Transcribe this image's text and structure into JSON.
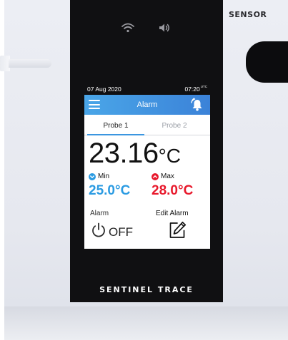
{
  "device": {
    "brand_label": "SENSOR",
    "device_name": "SENTINEL TRACE",
    "colors": {
      "case": "#e8eaf0",
      "bezel": "#101012",
      "screen_bg": "#ffffff"
    },
    "status_icons": [
      "wifi-icon",
      "speaker-icon"
    ]
  },
  "statusbar": {
    "date": "07 Aug 2020",
    "time": "07:20",
    "time_suffix": "UTC"
  },
  "appbar": {
    "title": "Alarm",
    "menu_icon": "hamburger-menu-icon",
    "action_icon": "alarm-bell-icon",
    "color": "#3b8fe0"
  },
  "tabs": [
    {
      "label": "Probe 1",
      "selected": true
    },
    {
      "label": "Probe 2",
      "selected": false
    }
  ],
  "reading": {
    "value": "23.16",
    "unit": "°C"
  },
  "min": {
    "label": "Min",
    "value": "25.0°C",
    "color": "#2b9be2",
    "icon": "chevron-down-circle-icon"
  },
  "max": {
    "label": "Max",
    "value": "28.0°C",
    "color": "#e8192c",
    "icon": "chevron-up-circle-icon"
  },
  "alarm": {
    "label": "Alarm",
    "state": "OFF",
    "icon": "power-icon"
  },
  "edit_alarm": {
    "label": "Edit Alarm",
    "icon": "edit-pencil-icon"
  }
}
